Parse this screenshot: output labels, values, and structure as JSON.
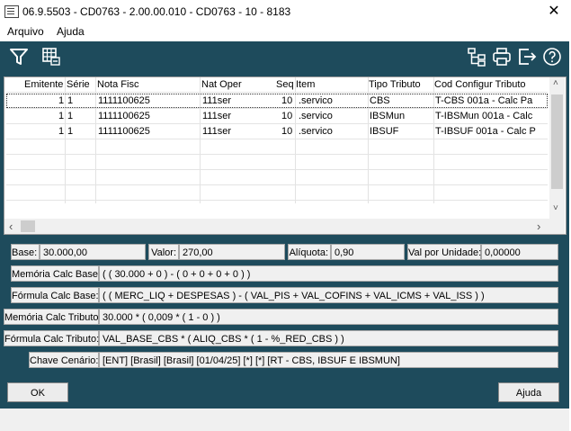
{
  "window": {
    "title": "06.9.5503 - CD0763 - 2.00.00.010 - CD0763 - 10 - 8183",
    "close_glyph": "✕"
  },
  "menu": {
    "items": [
      "Arquivo",
      "Ajuda"
    ]
  },
  "toolbar": {
    "left_icons": [
      "filter-icon",
      "grid-export-icon"
    ],
    "right_icons": [
      "tree-structure-icon",
      "printer-icon",
      "exit-icon",
      "help-icon"
    ]
  },
  "grid": {
    "headers": [
      "Emitente",
      "Série",
      "Nota Fisc",
      "Nat Oper",
      "Seq",
      "Item",
      "Tipo Tributo",
      "Cod Configur Tributo"
    ],
    "rows": [
      [
        "1",
        "1",
        "1111100625",
        "111ser",
        "10",
        ".servico",
        "CBS",
        "T-CBS 001a - Calc Pa"
      ],
      [
        "1",
        "1",
        "1111100625",
        "111ser",
        "10",
        ".servico",
        "IBSMun",
        "T-IBSMun 001a - Calc"
      ],
      [
        "1",
        "1",
        "1111100625",
        "111ser",
        "10",
        ".servico",
        "IBSUF",
        "T-IBSUF 001a - Calc P"
      ]
    ],
    "scroll_left": "‹",
    "scroll_right": "›",
    "scroll_up": "˄",
    "scroll_down": "˅"
  },
  "details": {
    "base_label": "Base:",
    "base_value": "30.000,00",
    "valor_label": "Valor:",
    "valor_value": "270,00",
    "aliquota_label": "Alíquota:",
    "aliquota_value": "0,90",
    "valunid_label": "Val por Unidade:",
    "valunid_value": "0,00000",
    "mem_base_label": "Memória Calc Base:",
    "mem_base_value": "( ( 30.000 + 0 ) - ( 0 + 0 + 0 + 0 ) )",
    "form_base_label": "Fórmula Calc Base:",
    "form_base_value": "( ( MERC_LIQ + DESPESAS ) - ( VAL_PIS + VAL_COFINS + VAL_ICMS + VAL_ISS ) )",
    "mem_trib_label": "Memória Calc Tributo:",
    "mem_trib_value": "30.000 * ( 0,009 * ( 1 - 0 ) )",
    "form_trib_label": "Fórmula Calc Tributo:",
    "form_trib_value": "VAL_BASE_CBS * ( ALIQ_CBS * ( 1 - %_RED_CBS ) )",
    "chave_label": "Chave Cenário:",
    "chave_value": "[ENT] [Brasil] [Brasil] [01/04/25] [*] [*] [RT - CBS, IBSUF E IBSMUN]"
  },
  "buttons": {
    "ok": "OK",
    "ajuda": "Ajuda"
  },
  "colors": {
    "panel": "#1e4b5c",
    "background": "#f0f0f0"
  }
}
